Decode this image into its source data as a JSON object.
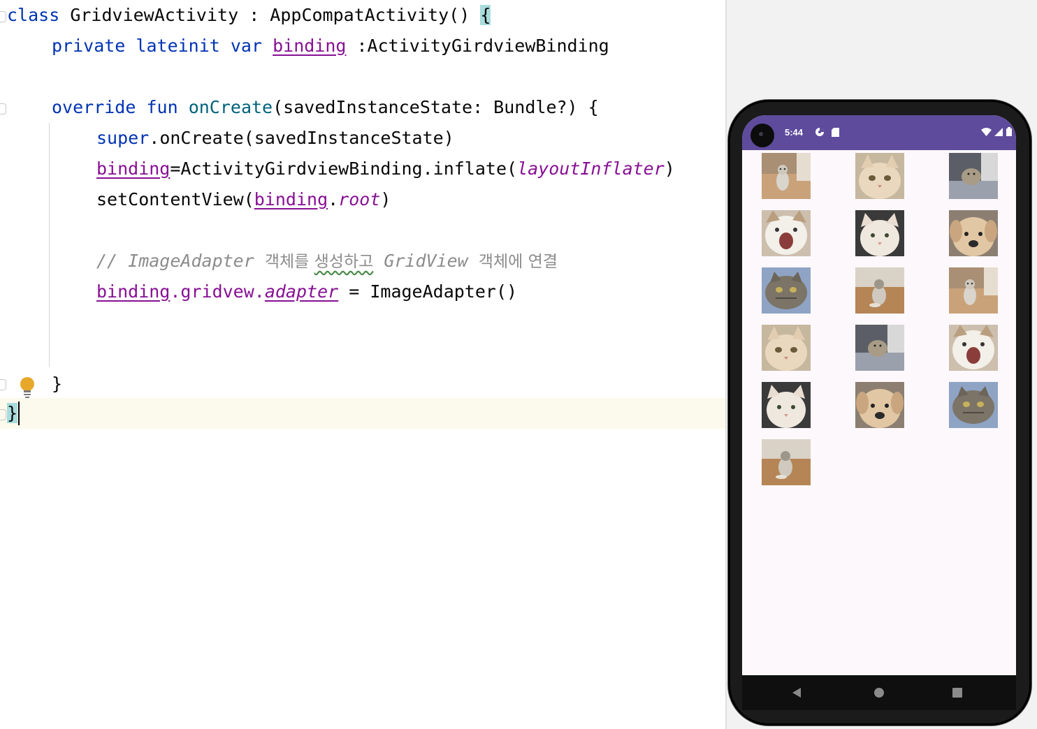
{
  "editor": {
    "language": "kotlin",
    "lines": {
      "l1": {
        "kw": "class",
        "rest": " GridviewActivity : AppCompatActivity() ",
        "brace": "{"
      },
      "l2": {
        "kw": "private lateinit var",
        "prop": "binding",
        "rest": " :ActivityGirdviewBinding"
      },
      "l4": {
        "kw": "override fun",
        "fn": "onCreate",
        "rest": "(savedInstanceState: Bundle?) {"
      },
      "l5": {
        "kw": "super",
        "rest": ".onCreate(savedInstanceState)"
      },
      "l6": {
        "prop": "binding",
        "rest": "=ActivityGirdviewBinding.inflate(",
        "it": "layoutInflater",
        "end": ")"
      },
      "l7": {
        "pre": "setContentView(",
        "prop": "binding",
        "dot": ".",
        "it": "root",
        "end": ")"
      },
      "l9": {
        "c1": "// ImageAdapter ",
        "k1": "객체를 ",
        "k2": "생성하고",
        "c2": " GridView ",
        "k3": "객체에 연결"
      },
      "l10": {
        "prop": "binding",
        "mid": ".gridvew.",
        "prop2": "adapter",
        "rest": " = ImageAdapter()"
      },
      "l12": {
        "rest": "}"
      },
      "l13": {
        "brace": "}"
      }
    }
  },
  "emulator": {
    "status_bar": {
      "time": "5:44",
      "left_icons": [
        "settings-icon",
        "sd-card-icon"
      ],
      "right_icons": [
        "wifi-icon",
        "signal-icon",
        "battery-icon"
      ],
      "color": "#5e4b9c"
    },
    "grid": {
      "columns": 3,
      "images": [
        "cat-standing-floor",
        "cat-face-closeup",
        "cat-lying-blanket",
        "cat-yawning",
        "cat-white-face",
        "dog-face-closeup",
        "cat-tabby-lying",
        "cat-sitting-floor",
        "cat-standing-floor",
        "cat-face-closeup",
        "cat-lying-blanket",
        "cat-yawning",
        "cat-white-face",
        "dog-face-closeup",
        "cat-tabby-lying",
        "cat-sitting-floor"
      ]
    },
    "nav_bar": {
      "buttons": [
        "back-icon",
        "home-icon",
        "recents-icon"
      ]
    }
  },
  "colors": {
    "keyword": "#0033b3",
    "function": "#00627a",
    "property": "#871094",
    "comment": "#8c8c8c",
    "status_bar": "#5e4b9c",
    "current_line": "#fcfaed"
  }
}
